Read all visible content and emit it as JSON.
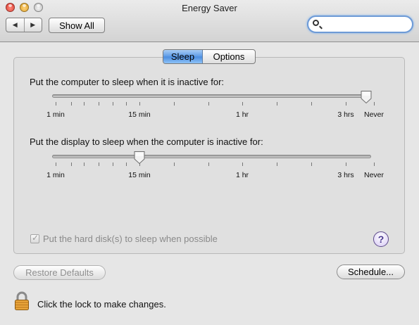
{
  "window": {
    "title": "Energy Saver"
  },
  "toolbar": {
    "back_icon": "chevron-left-icon",
    "forward_icon": "chevron-right-icon",
    "show_all_label": "Show All",
    "search_placeholder": ""
  },
  "tabs": [
    {
      "label": "Sleep",
      "selected": true
    },
    {
      "label": "Options",
      "selected": false
    }
  ],
  "computer_sleep": {
    "label": "Put the computer to sleep when it is inactive for:",
    "tick_labels": [
      "1 min",
      "15 min",
      "1 hr",
      "3 hrs",
      "Never"
    ],
    "value": "Never"
  },
  "display_sleep": {
    "label": "Put the display to sleep when the computer is inactive for:",
    "tick_labels": [
      "1 min",
      "15 min",
      "1 hr",
      "3 hrs",
      "Never"
    ],
    "value": "15 min"
  },
  "hard_disk": {
    "label": "Put the hard disk(s) to sleep when possible",
    "checked": true,
    "enabled": false
  },
  "help_label": "?",
  "buttons": {
    "restore_defaults": "Restore Defaults",
    "schedule": "Schedule..."
  },
  "lock": {
    "message": "Click the lock to make changes.",
    "icon": "padlock-icon"
  },
  "colors": {
    "selected_tab": "#5b9ae6",
    "search_focus_ring": "#6d9ad6",
    "help_button": "#d6c8f4"
  }
}
